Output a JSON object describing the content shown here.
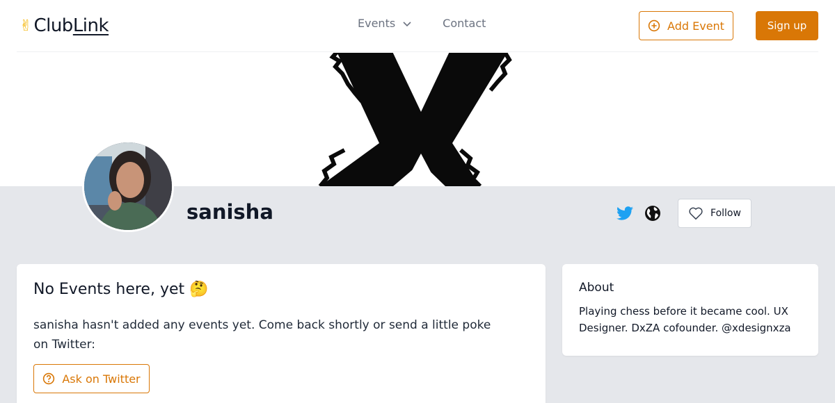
{
  "header": {
    "logo_emoji": "✌",
    "logo_club": "Club",
    "logo_link": "Link",
    "nav": {
      "events": "Events",
      "contact": "Contact"
    },
    "add_event": "Add Event",
    "sign_up": "Sign up"
  },
  "profile": {
    "username": "sanisha",
    "follow": "Follow"
  },
  "events_card": {
    "title": "No Events here, yet 🤔",
    "text": "sanisha hasn't added any events yet. Come back shortly or send a little poke on Twitter:",
    "ask_button": "Ask on Twitter"
  },
  "about_card": {
    "title": "About",
    "text": "Playing chess before it became cool. UX Designer. DxZA cofounder. @xdesignxza"
  },
  "colors": {
    "accent": "#d97706",
    "twitter": "#1da1f2",
    "page_bg": "#e5e7eb"
  },
  "icons": [
    "chevron-down-icon",
    "plus-circle-icon",
    "twitter-icon",
    "globe-icon",
    "heart-icon",
    "question-circle-icon"
  ]
}
